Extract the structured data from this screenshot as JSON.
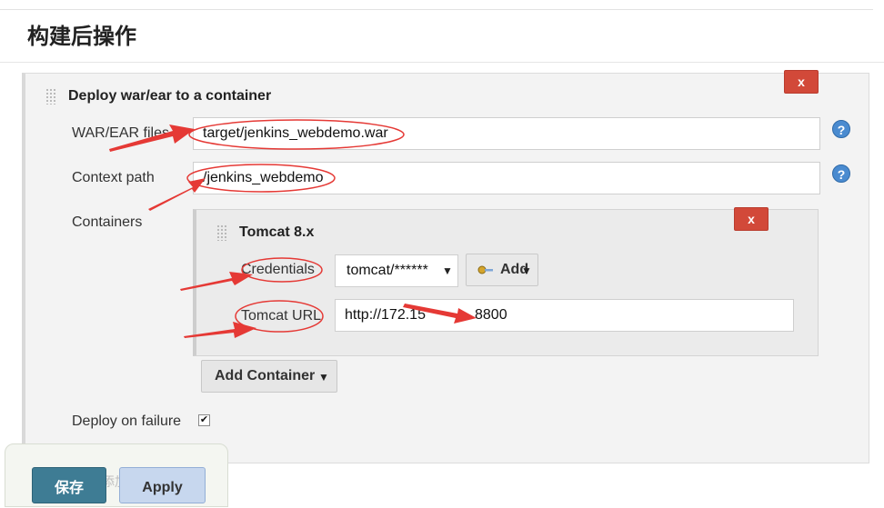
{
  "section": {
    "title": "构建后操作"
  },
  "deploy": {
    "title": "Deploy war/ear to a container",
    "delete_label": "x",
    "war_label": "WAR/EAR files",
    "war_value": "target/jenkins_webdemo.war",
    "context_label": "Context path",
    "context_value": "/jenkins_webdemo",
    "containers_label": "Containers",
    "help_glyph": "?"
  },
  "tomcat": {
    "title": "Tomcat 8.x",
    "delete_label": "x",
    "credentials_label": "Credentials",
    "credentials_value": "tomcat/******",
    "add_label": "Add",
    "url_label": "Tomcat URL",
    "url_value": "http://172.15",
    "url_value_end": "8800"
  },
  "add_container": {
    "label": "Add Container"
  },
  "deploy_failure": {
    "label": "Deploy on failure",
    "checked": true
  },
  "footer": {
    "save_label": "保存",
    "apply_label": "Apply",
    "faint_text": "添加"
  },
  "annotation_color": "#e53935"
}
